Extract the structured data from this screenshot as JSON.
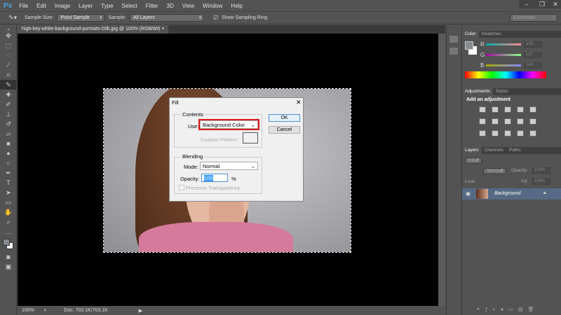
{
  "app": {
    "logo": "Ps",
    "menu": [
      "File",
      "Edit",
      "Image",
      "Layer",
      "Type",
      "Select",
      "Filter",
      "3D",
      "View",
      "Window",
      "Help"
    ]
  },
  "options": {
    "sample_size_label": "Sample Size:",
    "sample_size": "Point Sample",
    "sample_label": "Sample:",
    "sample": "All Layers",
    "ring_label": "Show Sampling Ring",
    "ring_checked": true,
    "workspace": "Essentials"
  },
  "document": {
    "tab": "high-key-white-background-portraits-03b.jpg @ 100% (RGB/8#)",
    "zoom": "100%",
    "doc_size": "Doc: 703.1K/703.1K"
  },
  "color_panel": {
    "tabs": [
      "Color",
      "Swatches"
    ],
    "channels": [
      {
        "label": "R",
        "value": "133"
      },
      {
        "label": "G",
        "value": "137"
      },
      {
        "label": "B",
        "value": "140"
      }
    ],
    "foreground": "#858990",
    "background": "#ffffff"
  },
  "adjustments": {
    "tabs": [
      "Adjustments",
      "Styles"
    ],
    "heading": "Add an adjustment"
  },
  "layers": {
    "tabs": [
      "Layers",
      "Channels",
      "Paths"
    ],
    "kind": "Kind",
    "blend": "Normal",
    "opacity_label": "Opacity:",
    "opacity": "100%",
    "lock_label": "Lock:",
    "fill_label": "Fill:",
    "fill": "100%",
    "layer_name": "Background"
  },
  "dialog": {
    "title": "Fill",
    "contents_legend": "Contents",
    "use_label": "Use:",
    "use_value": "Background Color",
    "custom_pattern_label": "Custom Pattern:",
    "ok": "OK",
    "cancel": "Cancel",
    "blending_legend": "Blending",
    "mode_label": "Mode:",
    "mode_value": "Normal",
    "opacity_label": "Opacity:",
    "opacity_value": "100",
    "percent": "%",
    "preserve_label": "Preserve Transparency",
    "highlight_color": "#e01818"
  }
}
